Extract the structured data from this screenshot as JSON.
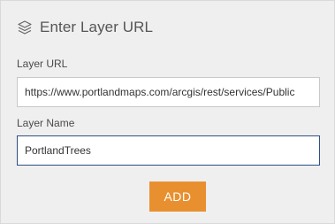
{
  "dialog": {
    "title": "Enter Layer URL",
    "title_icon": "layers-icon"
  },
  "layer_url": {
    "label": "Layer URL",
    "value": "https://www.portlandmaps.com/arcgis/rest/services/Public"
  },
  "layer_name": {
    "label": "Layer Name",
    "value": "PortlandTrees"
  },
  "actions": {
    "add_label": "ADD"
  },
  "colors": {
    "panel_background": "#efefef",
    "accent_button": "#e8902f",
    "focused_border": "#2f4f86"
  }
}
